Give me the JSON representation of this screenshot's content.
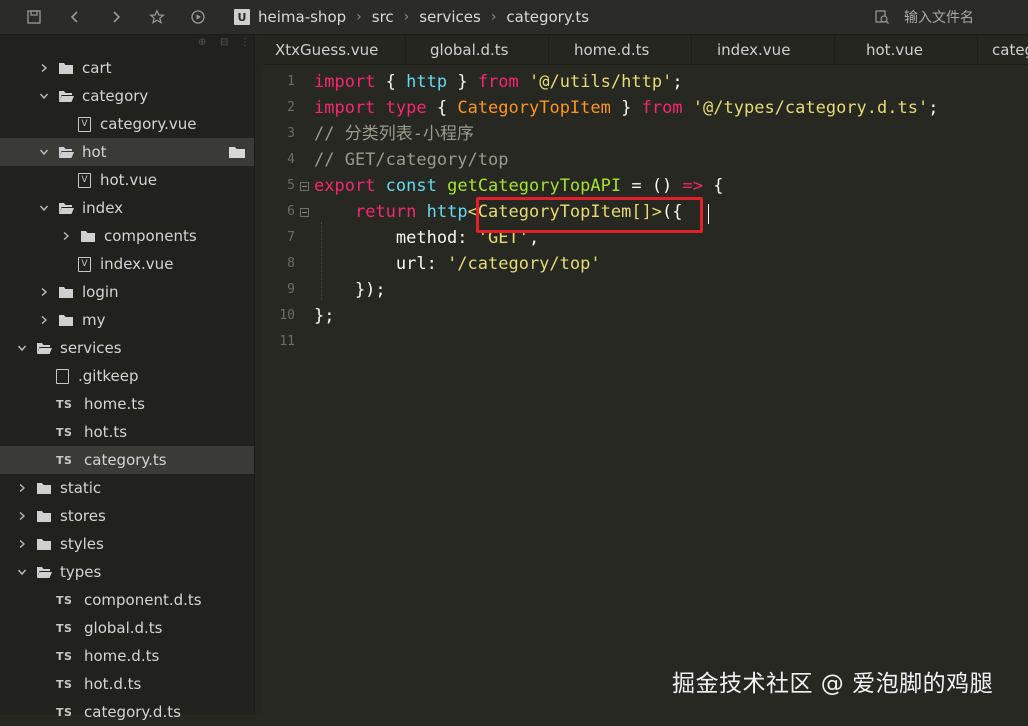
{
  "toolbar": {
    "breadcrumbs": [
      "heima-shop",
      "src",
      "services",
      "category.ts"
    ],
    "file_search_placeholder": "输入文件名",
    "logo_text": "U"
  },
  "sidebar": {
    "items": [
      {
        "label": "cart",
        "type": "folder",
        "expanded": false,
        "depth": 2
      },
      {
        "label": "category",
        "type": "folder",
        "expanded": true,
        "depth": 2
      },
      {
        "label": "category.vue",
        "type": "vue",
        "depth": 3
      },
      {
        "label": "hot",
        "type": "folder",
        "expanded": true,
        "depth": 2,
        "selected": true
      },
      {
        "label": "hot.vue",
        "type": "vue",
        "depth": 3
      },
      {
        "label": "index",
        "type": "folder",
        "expanded": true,
        "depth": 2
      },
      {
        "label": "components",
        "type": "folder",
        "expanded": false,
        "depth": 3
      },
      {
        "label": "index.vue",
        "type": "vue",
        "depth": 3
      },
      {
        "label": "login",
        "type": "folder",
        "expanded": false,
        "depth": 2
      },
      {
        "label": "my",
        "type": "folder",
        "expanded": false,
        "depth": 2
      },
      {
        "label": "services",
        "type": "folder",
        "expanded": true,
        "depth": 1
      },
      {
        "label": ".gitkeep",
        "type": "file",
        "depth": 2
      },
      {
        "label": "home.ts",
        "type": "ts",
        "depth": 2
      },
      {
        "label": "hot.ts",
        "type": "ts",
        "depth": 2
      },
      {
        "label": "category.ts",
        "type": "ts",
        "depth": 2,
        "selected": true
      },
      {
        "label": "static",
        "type": "folder",
        "expanded": false,
        "depth": 1
      },
      {
        "label": "stores",
        "type": "folder",
        "expanded": false,
        "depth": 1
      },
      {
        "label": "styles",
        "type": "folder",
        "expanded": false,
        "depth": 1
      },
      {
        "label": "types",
        "type": "folder",
        "expanded": true,
        "depth": 1
      },
      {
        "label": "component.d.ts",
        "type": "ts",
        "depth": 2
      },
      {
        "label": "global.d.ts",
        "type": "ts",
        "depth": 2
      },
      {
        "label": "home.d.ts",
        "type": "ts",
        "depth": 2
      },
      {
        "label": "hot.d.ts",
        "type": "ts",
        "depth": 2
      },
      {
        "label": "category.d.ts",
        "type": "ts",
        "depth": 2
      }
    ],
    "ts_badge": "TS",
    "vue_badge": "V"
  },
  "tabs": [
    "XtxGuess.vue",
    "global.d.ts",
    "home.d.ts",
    "index.vue",
    "hot.vue",
    "category.ts"
  ],
  "editor": {
    "line_numbers": [
      "1",
      "2",
      "3",
      "4",
      "5",
      "6",
      "7",
      "8",
      "9",
      "10",
      "11"
    ],
    "lines": [
      [
        [
          "kw",
          "import"
        ],
        [
          "plain",
          " { "
        ],
        [
          "ty",
          "http"
        ],
        [
          "plain",
          " } "
        ],
        [
          "kw",
          "from"
        ],
        [
          "plain",
          " "
        ],
        [
          "str",
          "'@/utils/http'"
        ],
        [
          "plain",
          ";"
        ]
      ],
      [
        [
          "kw",
          "import"
        ],
        [
          "plain",
          " "
        ],
        [
          "kw",
          "type"
        ],
        [
          "plain",
          " { "
        ],
        [
          "cls",
          "CategoryTopItem"
        ],
        [
          "plain",
          " } "
        ],
        [
          "kw",
          "from"
        ],
        [
          "plain",
          " "
        ],
        [
          "str",
          "'@/types/category.d.ts'"
        ],
        [
          "plain",
          ";"
        ]
      ],
      [
        [
          "cm",
          "// 分类列表-小程序"
        ]
      ],
      [
        [
          "cm",
          "// GET/category/top"
        ]
      ],
      [
        [
          "kw",
          "export"
        ],
        [
          "plain",
          " "
        ],
        [
          "ty",
          "const"
        ],
        [
          "plain",
          " "
        ],
        [
          "fn",
          "getCategoryTopAPI"
        ],
        [
          "plain",
          " = () "
        ],
        [
          "kw",
          "=>"
        ],
        [
          "plain",
          " {"
        ]
      ],
      [
        [
          "plain",
          "    "
        ],
        [
          "kw",
          "return"
        ],
        [
          "plain",
          " "
        ],
        [
          "ty",
          "http"
        ],
        [
          "gtype",
          "<CategoryTopItem[]>"
        ],
        [
          "plain",
          "({"
        ]
      ],
      [
        [
          "plain",
          "        method: "
        ],
        [
          "str",
          "'GET'"
        ],
        [
          "plain",
          ","
        ]
      ],
      [
        [
          "plain",
          "        url: "
        ],
        [
          "str",
          "'/category/top'"
        ]
      ],
      [
        [
          "plain",
          "    });"
        ]
      ],
      [
        [
          "plain",
          "};"
        ]
      ],
      [
        [
          "plain",
          ""
        ]
      ]
    ]
  },
  "watermark": "掘金技术社区 @ 爱泡脚的鸡腿"
}
